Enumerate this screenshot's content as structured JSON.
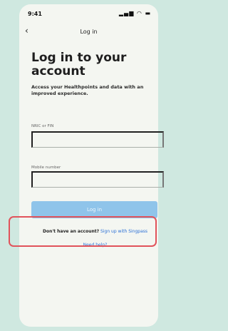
{
  "status": {
    "time": "9:41",
    "icons": "signal wifi battery"
  },
  "nav": {
    "back": "‹",
    "title": "Log in"
  },
  "heading": "Log in to your account",
  "subtitle": "Access your Healthpoints and data with an improved experience.",
  "fields": [
    {
      "label": "NRIC or FIN",
      "value": ""
    },
    {
      "label": "Mobile number",
      "value": ""
    }
  ],
  "login_button": "Log in",
  "signup": {
    "question": "Don't have an account?",
    "link": "Sign up with Singpass"
  },
  "help_link": "Need help?",
  "colors": {
    "background": "#cfe8e0",
    "button": "#8fc4ea",
    "link": "#2a6fd6",
    "highlight": "#e1535b"
  }
}
